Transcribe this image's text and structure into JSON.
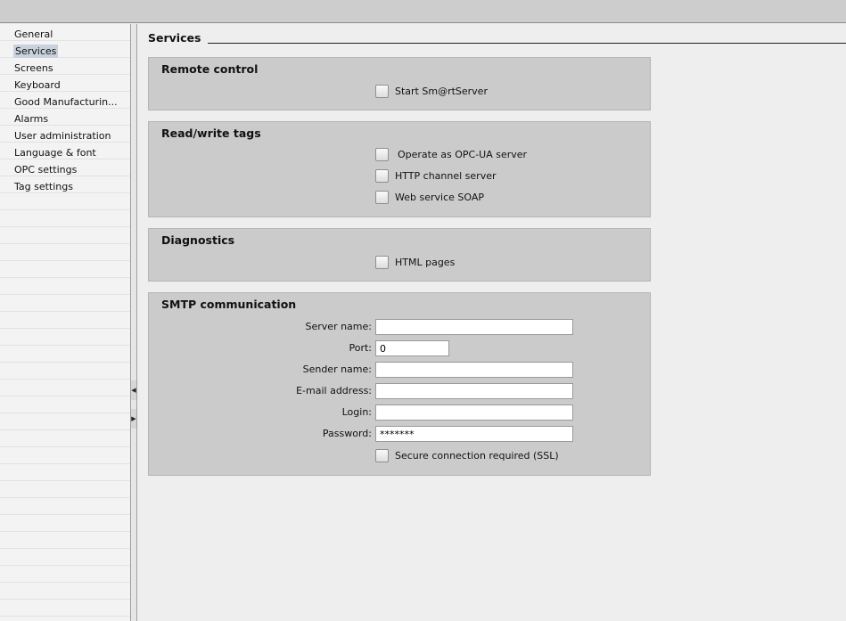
{
  "sidebar": {
    "items": [
      {
        "label": "General"
      },
      {
        "label": "Services",
        "selected": true
      },
      {
        "label": "Screens"
      },
      {
        "label": "Keyboard"
      },
      {
        "label": "Good Manufacturin..."
      },
      {
        "label": "Alarms"
      },
      {
        "label": "User administration"
      },
      {
        "label": "Language & font"
      },
      {
        "label": "OPC settings"
      },
      {
        "label": "Tag settings"
      }
    ]
  },
  "main": {
    "title": "Services",
    "remote_control": {
      "title": "Remote control",
      "start_smartserver": "Start Sm@rtServer"
    },
    "read_write_tags": {
      "title": "Read/write tags",
      "opc_ua": "Operate as OPC-UA server",
      "http_channel": "HTTP channel server",
      "soap": "Web service SOAP"
    },
    "diagnostics": {
      "title": "Diagnostics",
      "html_pages": "HTML pages"
    },
    "smtp": {
      "title": "SMTP communication",
      "server_name_label": "Server name:",
      "server_name": "",
      "port_label": "Port:",
      "port": "0",
      "sender_name_label": "Sender name:",
      "sender_name": "",
      "email_label": "E-mail address:",
      "email": "",
      "login_label": "Login:",
      "login": "",
      "password_label": "Password:",
      "password": "*******",
      "ssl": "Secure connection required (SSL)"
    }
  }
}
